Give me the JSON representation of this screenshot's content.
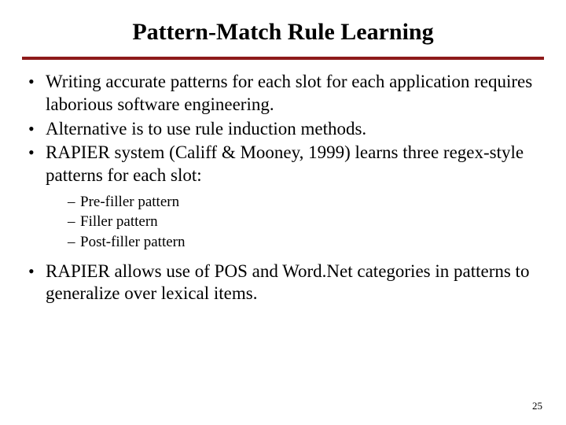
{
  "title": "Pattern-Match Rule Learning",
  "bullets": {
    "b1": "Writing accurate patterns for each slot for each application requires laborious software engineering.",
    "b2": "Alternative is to use rule induction methods.",
    "b3_prefix": "R",
    "b3_caps": "APIER",
    "b3_rest": " system (Califf & Mooney, 1999) learns three regex-style patterns for each slot:",
    "b4_prefix": "R",
    "b4_caps": "APIER",
    "b4_rest": " allows use of POS and Word.Net categories in patterns to generalize over lexical items."
  },
  "sub": {
    "s1": "Pre-filler pattern",
    "s2": "Filler pattern",
    "s3": "Post-filler pattern"
  },
  "pageNumber": "25"
}
